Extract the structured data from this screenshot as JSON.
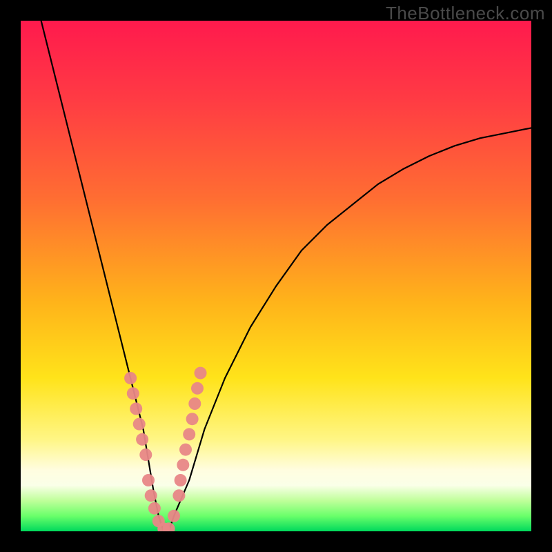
{
  "watermark": "TheBottleneck.com",
  "chart_data": {
    "type": "line",
    "title": "",
    "xlabel": "",
    "ylabel": "",
    "xlim": [
      0,
      100
    ],
    "ylim": [
      0,
      100
    ],
    "grid": false,
    "legend": false,
    "curve": {
      "name": "bottleneck-curve",
      "x": [
        4,
        6,
        8,
        10,
        12,
        14,
        16,
        18,
        20,
        22,
        24,
        25,
        26,
        27,
        28,
        29,
        30,
        33,
        36,
        40,
        45,
        50,
        55,
        60,
        65,
        70,
        75,
        80,
        85,
        90,
        95,
        100
      ],
      "y_pct": [
        100,
        92,
        84,
        76,
        68,
        60,
        52,
        44,
        36,
        28,
        20,
        14,
        8,
        3,
        0,
        0,
        3,
        10,
        20,
        30,
        40,
        48,
        55,
        60,
        64,
        68,
        71,
        73.5,
        75.5,
        77,
        78,
        79
      ]
    },
    "scatter": {
      "name": "measured-points",
      "color": "#e88787",
      "x": [
        21.5,
        22.0,
        22.6,
        23.2,
        23.8,
        24.5,
        25.0,
        25.5,
        26.2,
        27.0,
        28.0,
        29.0,
        30.0,
        31.0,
        31.3,
        31.8,
        32.3,
        33.0,
        33.6,
        34.1,
        34.6,
        35.2
      ],
      "y_pct": [
        30.0,
        27.0,
        24.0,
        21.0,
        18.0,
        15.0,
        10.0,
        7.0,
        4.5,
        2.0,
        0.5,
        0.5,
        3.0,
        7.0,
        10.0,
        13.0,
        16.0,
        19.0,
        22.0,
        25.0,
        28.0,
        31.0
      ]
    },
    "gradient_stops": [
      {
        "pct": 0,
        "color": "#ff1a4d"
      },
      {
        "pct": 15,
        "color": "#ff3a44"
      },
      {
        "pct": 35,
        "color": "#ff6e32"
      },
      {
        "pct": 55,
        "color": "#ffb31a"
      },
      {
        "pct": 70,
        "color": "#ffe31a"
      },
      {
        "pct": 82,
        "color": "#fff685"
      },
      {
        "pct": 88,
        "color": "#fffde0"
      },
      {
        "pct": 91,
        "color": "#faffe8"
      },
      {
        "pct": 94,
        "color": "#bfff9a"
      },
      {
        "pct": 97,
        "color": "#6aff6a"
      },
      {
        "pct": 100,
        "color": "#00d95c"
      }
    ]
  }
}
